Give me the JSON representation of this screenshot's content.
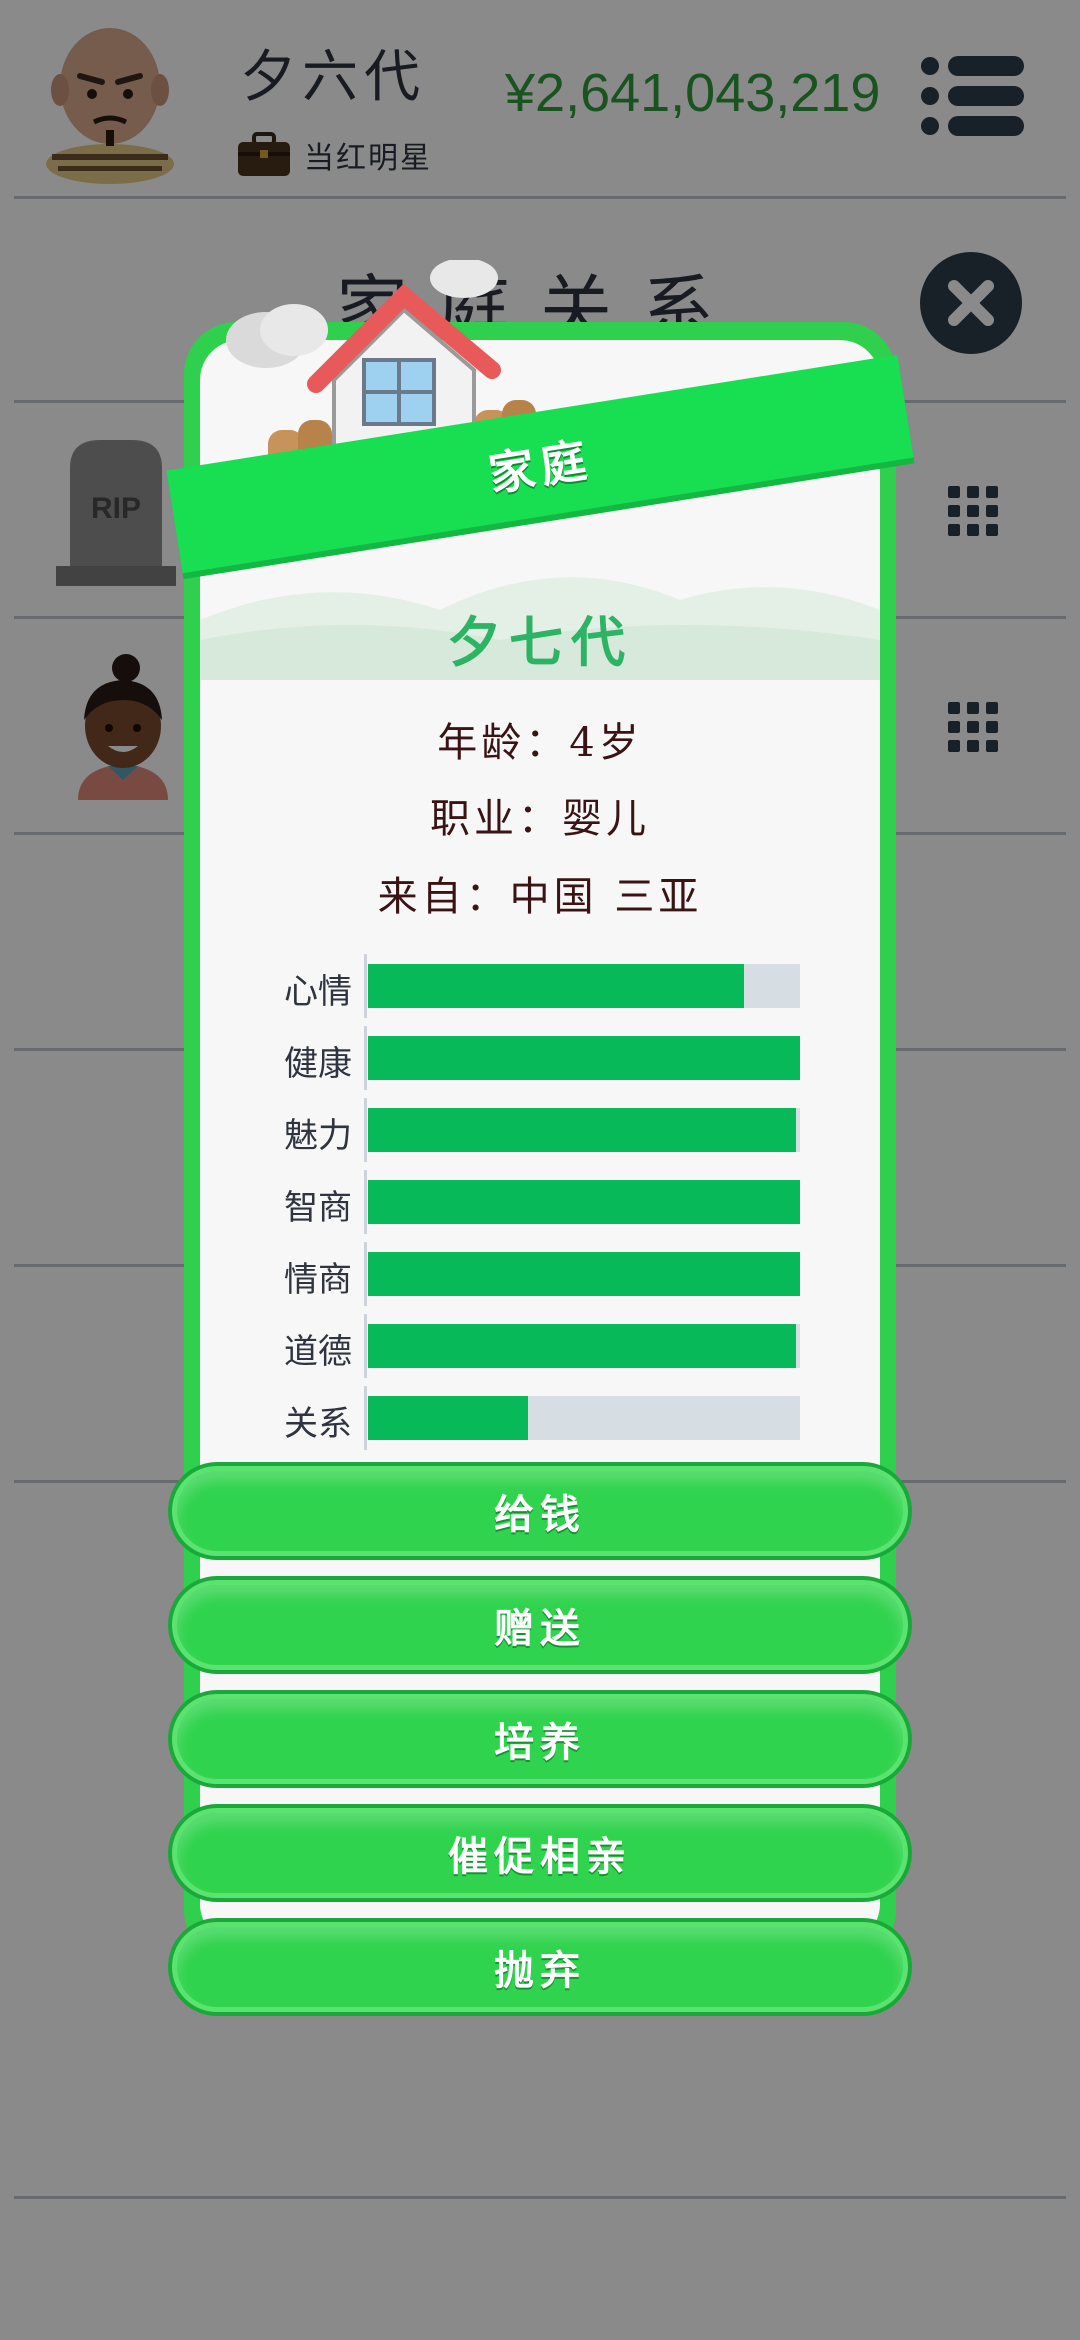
{
  "header": {
    "player_name": "夕六代",
    "job": "当红明星",
    "money": "¥2,641,043,219",
    "avatar_icon": "old-man-avatar-icon",
    "job_icon": "briefcase-icon",
    "menu_icon": "menu-icon"
  },
  "page": {
    "title": "家庭关系",
    "close_icon": "close-icon"
  },
  "relatives": [
    {
      "avatar": "rip-tombstone-icon",
      "text": "RIP"
    },
    {
      "avatar": "child-girl-avatar-icon"
    }
  ],
  "modal": {
    "banner": "家庭",
    "name": "夕七代",
    "age_line": "年龄：4岁",
    "job_line": "职业：婴儿",
    "from_line": "来自：中国 三亚",
    "stats": [
      {
        "label": "心情",
        "value": 0.87
      },
      {
        "label": "健康",
        "value": 1.0
      },
      {
        "label": "魅力",
        "value": 0.99
      },
      {
        "label": "智商",
        "value": 1.0
      },
      {
        "label": "情商",
        "value": 1.0
      },
      {
        "label": "道德",
        "value": 0.99
      },
      {
        "label": "关系",
        "value": 0.37
      }
    ],
    "actions": [
      "给钱",
      "赠送",
      "培养",
      "催促相亲",
      "抛弃"
    ]
  },
  "colors": {
    "accent_green": "#2ed04d",
    "bar_fill": "#08b95a",
    "bar_track": "#d6dde3",
    "money_green": "#2f9a3a",
    "name_green": "#2db364"
  }
}
